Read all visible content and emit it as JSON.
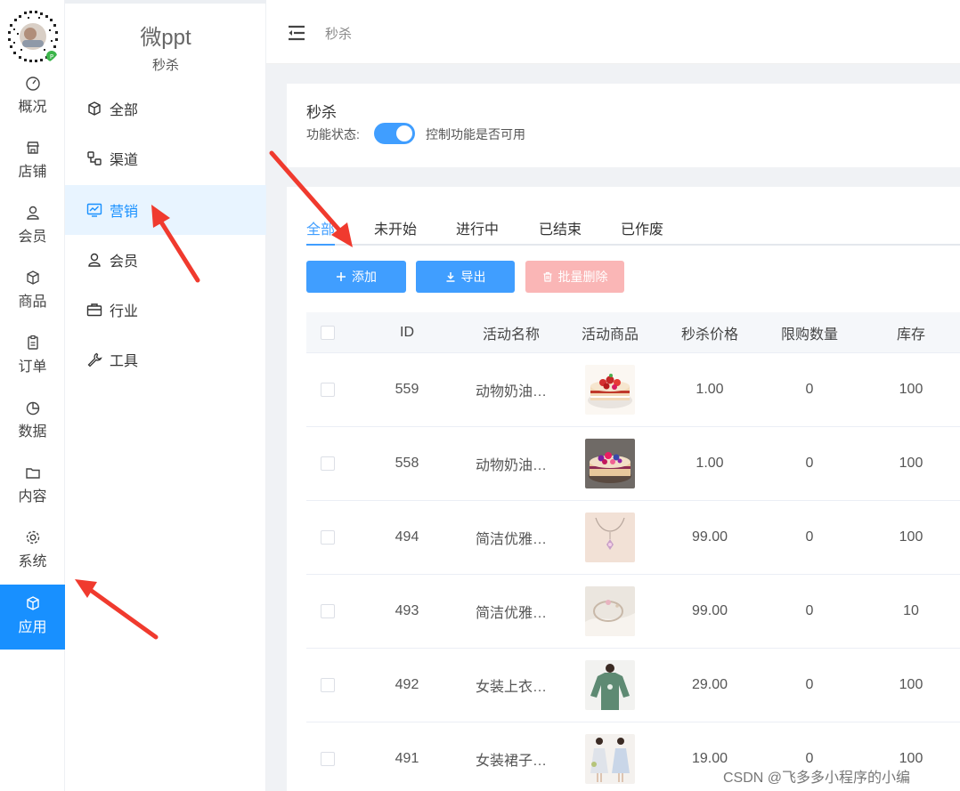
{
  "app": {
    "title": "微ppt",
    "subtitle": "秒杀"
  },
  "rail": {
    "items": [
      {
        "label": "概况",
        "icon": "dashboard-icon"
      },
      {
        "label": "店铺",
        "icon": "store-icon"
      },
      {
        "label": "会员",
        "icon": "user-icon"
      },
      {
        "label": "商品",
        "icon": "box-icon"
      },
      {
        "label": "订单",
        "icon": "clipboard-icon"
      },
      {
        "label": "数据",
        "icon": "pie-chart-icon"
      },
      {
        "label": "内容",
        "icon": "folder-icon"
      },
      {
        "label": "系统",
        "icon": "gear-icon"
      },
      {
        "label": "应用",
        "icon": "cube-icon",
        "active": true
      }
    ]
  },
  "submenu": {
    "items": [
      {
        "label": "全部",
        "icon": "cube-icon"
      },
      {
        "label": "渠道",
        "icon": "channel-icon"
      },
      {
        "label": "营销",
        "icon": "monitor-chart-icon",
        "active": true
      },
      {
        "label": "会员",
        "icon": "user-icon"
      },
      {
        "label": "行业",
        "icon": "briefcase-icon"
      },
      {
        "label": "工具",
        "icon": "wrench-icon"
      }
    ]
  },
  "header": {
    "breadcrumb": "秒杀"
  },
  "settings": {
    "title": "秒杀",
    "status_label": "功能状态:",
    "status_on": true,
    "status_desc": "控制功能是否可用"
  },
  "tabs": [
    "全部",
    "未开始",
    "进行中",
    "已结束",
    "已作废"
  ],
  "actions": {
    "add": "添加",
    "export": "导出",
    "batch_delete": "批量删除"
  },
  "table": {
    "columns": [
      "ID",
      "活动名称",
      "活动商品",
      "秒杀价格",
      "限购数量",
      "库存"
    ],
    "rows": [
      {
        "id": "559",
        "name": "动物奶油…",
        "image": "cake-strawberry",
        "price": "1.00",
        "limit": "0",
        "stock": "100"
      },
      {
        "id": "558",
        "name": "动物奶油…",
        "image": "cake-berry",
        "price": "1.00",
        "limit": "0",
        "stock": "100"
      },
      {
        "id": "494",
        "name": "简洁优雅…",
        "image": "necklace",
        "price": "99.00",
        "limit": "0",
        "stock": "100"
      },
      {
        "id": "493",
        "name": "简洁优雅…",
        "image": "bracelet",
        "price": "99.00",
        "limit": "0",
        "stock": "10"
      },
      {
        "id": "492",
        "name": "女装上衣…",
        "image": "green-top",
        "price": "29.00",
        "limit": "0",
        "stock": "100"
      },
      {
        "id": "491",
        "name": "女装裙子…",
        "image": "dress",
        "price": "19.00",
        "limit": "0",
        "stock": "100"
      }
    ]
  },
  "watermark": "CSDN @飞多多小程序的小编",
  "colors": {
    "primary": "#409eff",
    "rail_active": "#1890ff",
    "danger_light": "#fab6b6",
    "arrow": "#f03a2e"
  }
}
